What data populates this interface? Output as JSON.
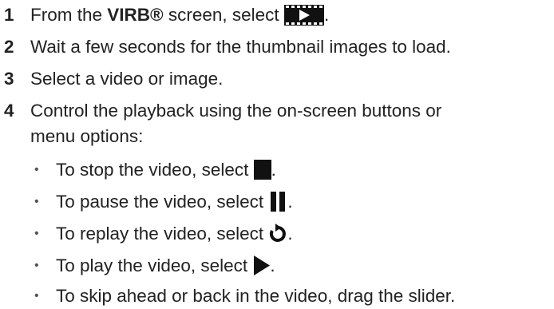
{
  "steps": [
    {
      "num": "1",
      "pre": "From the ",
      "bold": "VIRB®",
      "post": " screen, select ",
      "icon": "play-gallery-icon",
      "end": "."
    },
    {
      "num": "2",
      "text": "Wait a few seconds for the thumbnail images to load."
    },
    {
      "num": "3",
      "text": "Select a video or image."
    },
    {
      "num": "4",
      "line1": "Control the playback using the on-screen buttons or",
      "line2": "menu options:"
    }
  ],
  "bullets": [
    {
      "pre": "To stop the video, select ",
      "icon": "stop-icon",
      "end": "."
    },
    {
      "pre": "To pause the video, select ",
      "icon": "pause-icon",
      "end": "."
    },
    {
      "pre": "To replay the video, select ",
      "icon": "replay-icon",
      "end": "."
    },
    {
      "pre": "To play the video, select ",
      "icon": "play-icon",
      "end": "."
    },
    {
      "text": "To skip ahead or back in the video, drag the slider."
    }
  ],
  "bullet_char": "•"
}
